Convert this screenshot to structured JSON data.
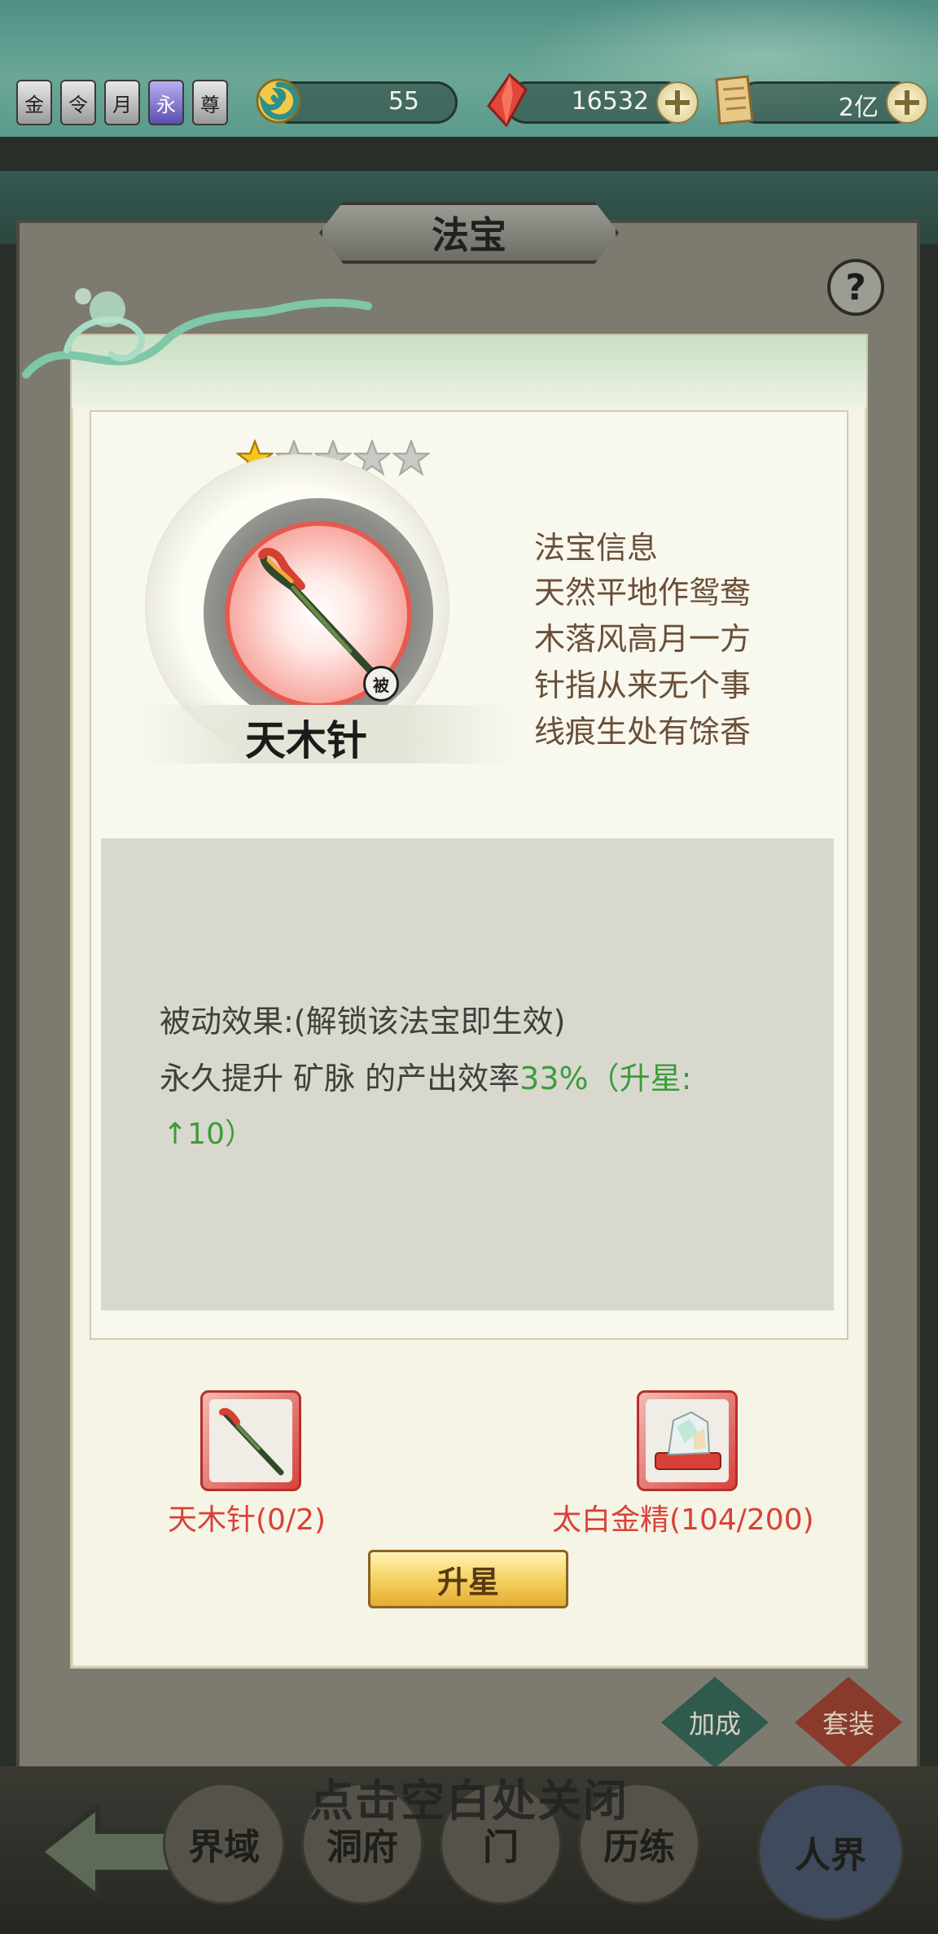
{
  "top_bar": {
    "badges": [
      "金",
      "令",
      "月",
      "永",
      "尊"
    ],
    "resources": [
      {
        "icon": "jade-swirl-icon",
        "value": "55",
        "has_plus": false
      },
      {
        "icon": "red-crystal-icon",
        "value": "16532",
        "has_plus": true
      },
      {
        "icon": "scroll-icon",
        "value": "2亿",
        "has_plus": true
      }
    ]
  },
  "background": {
    "title": "法宝",
    "help_label": "?",
    "side_buttons": [
      "加成",
      "套装"
    ],
    "bottom_tabs": [
      "界域",
      "洞府",
      "门",
      "历练",
      "人界"
    ],
    "close_hint": "点击空白处关闭"
  },
  "artifact": {
    "stars_filled": 1,
    "stars_total": 5,
    "name": "天木针",
    "badge": "被",
    "info_title": "法宝信息",
    "poem": [
      "天然平地作鸳鸯",
      "木落风高月一方",
      "针指从来无个事",
      "线痕生处有馀香"
    ]
  },
  "effect": {
    "line1": "被动效果:(解锁该法宝即生效)",
    "line2_prefix": "永久提升  矿脉  的产出效率",
    "line2_value": "33%",
    "line2_suffix": "（升星:",
    "line3": "↑10）"
  },
  "materials": [
    {
      "name": "天木针(0/2)",
      "icon": "needle-icon"
    },
    {
      "name": "太白金精(104/200)",
      "icon": "crystal-ore-icon"
    }
  ],
  "upstar_button": "升星",
  "colors": {
    "accent_green": "#3a9d3a",
    "material_red": "#d8413a",
    "poem_brown": "#6a4f38",
    "button_gold": "#f5d262"
  }
}
